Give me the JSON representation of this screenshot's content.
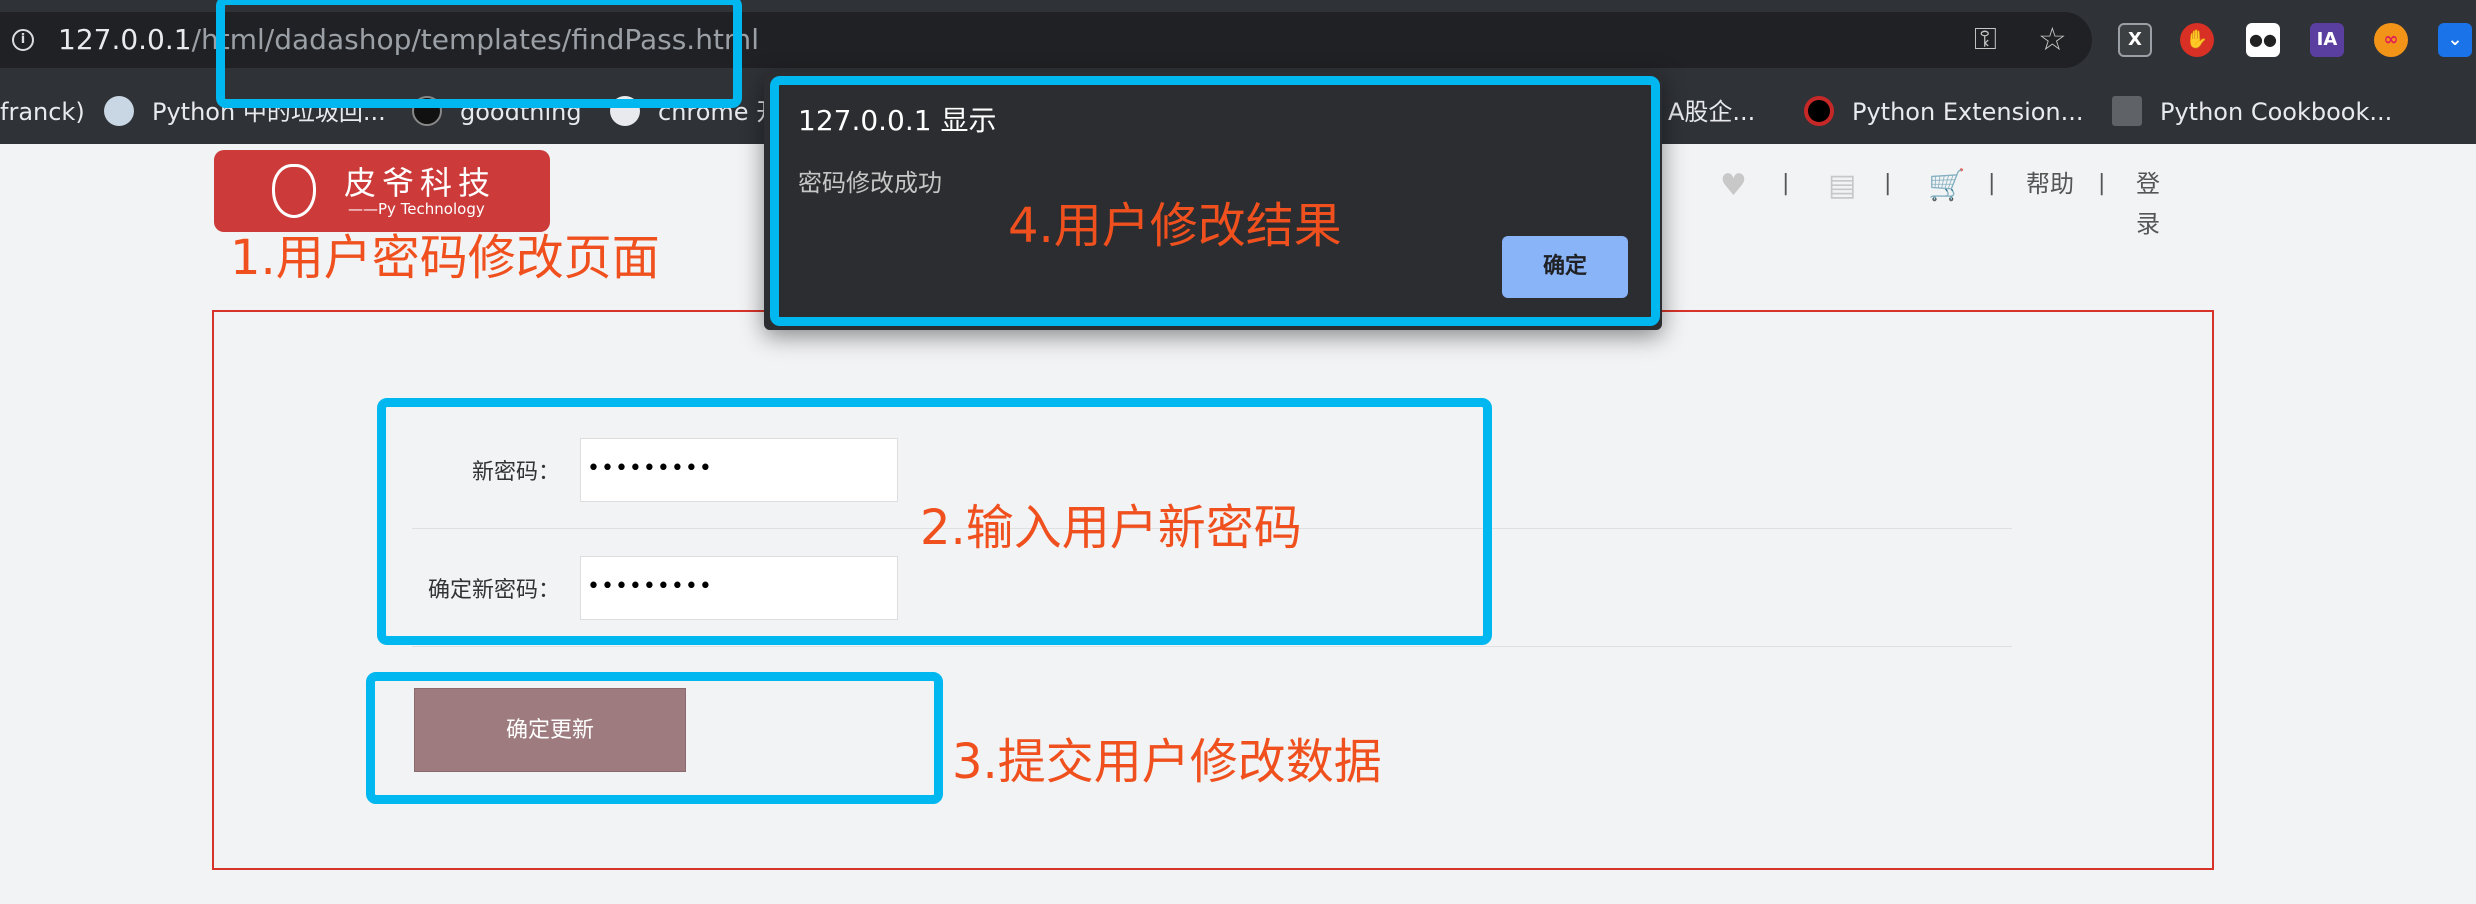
{
  "browser": {
    "url_host": "127.0.0.1",
    "url_path": "/html/dadashop/templates/findPass.html",
    "extensions": [
      "X",
      "stop-hand",
      "incognito",
      "IA",
      "∞",
      "chevrons"
    ],
    "bookmarks": [
      {
        "label": "franck)"
      },
      {
        "label": "Python 中的垃圾回..."
      },
      {
        "label": "goodthing"
      },
      {
        "label": "chrome 开"
      },
      {
        "label": "A股企..."
      },
      {
        "label": "Python Extension..."
      },
      {
        "label": "Python Cookbook..."
      }
    ]
  },
  "header": {
    "logo_brand": "皮爷科技",
    "logo_sub": "——Py Technology",
    "nav": {
      "help": "帮助",
      "login": "登录",
      "sep": "|"
    }
  },
  "form": {
    "new_password_label": "新密码：",
    "new_password_value": "•••••••••",
    "confirm_password_label": "确定新密码：",
    "confirm_password_value": "•••••••••",
    "submit_label": "确定更新"
  },
  "annotations": {
    "step1": "1.用户密码修改页面",
    "step2": "2.输入用户新密码",
    "step3": "3.提交用户修改数据",
    "step4": "4.用户修改结果"
  },
  "dialog": {
    "title": "127.0.0.1 显示",
    "message": "密码修改成功",
    "ok_label": "确定"
  },
  "colors": {
    "annotation_box": "#00b7ef",
    "annotation_text": "#f0501e",
    "form_border": "#d8332b",
    "logo_bg": "#cc3a3a",
    "submit_bg": "#9e7b7e",
    "dialog_button": "#8ab4f8"
  }
}
